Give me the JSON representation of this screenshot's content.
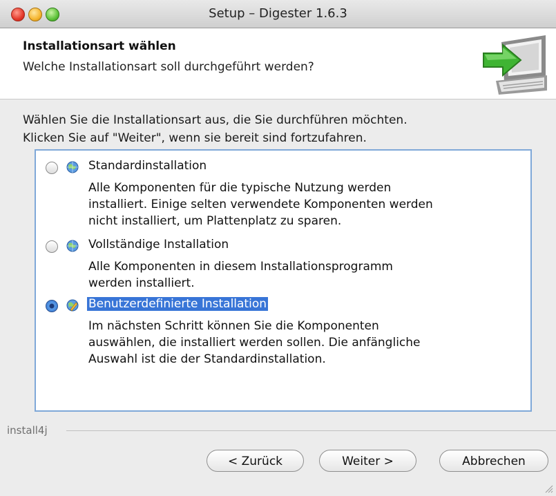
{
  "window": {
    "title": "Setup – Digester 1.6.3"
  },
  "header": {
    "title": "Installationsart wählen",
    "subtitle": "Welche Installationsart soll durchgeführt werden?",
    "icon": "install-computer-arrow-icon"
  },
  "instructions": {
    "line1": "Wählen Sie die Installationsart aus, die Sie durchführen möchten.",
    "line2": "Klicken Sie auf \"Weiter\", wenn sie bereit sind fortzufahren."
  },
  "options": [
    {
      "label": "Standardinstallation",
      "selected": false,
      "desc": [
        "Alle Komponenten für die typische Nutzung werden",
        "installiert. Einige selten verwendete Komponenten werden",
        "nicht installiert, um Plattenplatz zu sparen."
      ]
    },
    {
      "label": "Vollständige Installation",
      "selected": false,
      "desc": [
        "Alle Komponenten in diesem Installationsprogramm",
        "werden installiert."
      ]
    },
    {
      "label": "Benutzerdefinierte Installation",
      "selected": true,
      "desc": [
        "Im nächsten Schritt können Sie die Komponenten",
        "auswählen, die installiert werden sollen. Die anfängliche",
        "Auswahl ist die der Standardinstallation."
      ]
    }
  ],
  "footer": {
    "brand": "install4j",
    "back_label": "< Zurück",
    "next_label": "Weiter >",
    "cancel_label": "Abbrechen"
  },
  "colors": {
    "selection": "#3875d7",
    "panel_border": "#7fa8d8",
    "window_bg": "#ececec"
  }
}
